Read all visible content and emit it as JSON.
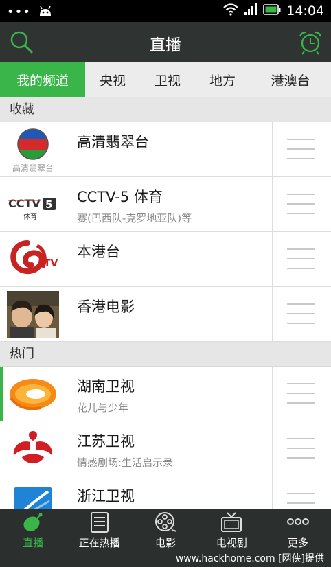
{
  "status_bar": {
    "time": "14:04"
  },
  "header": {
    "title": "直播"
  },
  "tabs": [
    {
      "label": "我的频道"
    },
    {
      "label": "央视"
    },
    {
      "label": "卫视"
    },
    {
      "label": "地方"
    },
    {
      "label": "港澳台"
    }
  ],
  "sections": {
    "favorites": {
      "title": "收藏",
      "channels": [
        {
          "name": "高清翡翠台",
          "sub": "",
          "logo_text": "高清翡翠台"
        },
        {
          "name": "CCTV-5 体育",
          "sub": "赛(巴西队-克罗地亚队)等",
          "logo_text": "体育"
        },
        {
          "name": "本港台",
          "sub": "",
          "logo_text": "TV"
        },
        {
          "name": "香港电影",
          "sub": ""
        }
      ]
    },
    "hot": {
      "title": "热门",
      "channels": [
        {
          "name": "湖南卫视",
          "sub": "花儿与少年"
        },
        {
          "name": "江苏卫视",
          "sub": "情感剧场:生活启示录"
        },
        {
          "name": "浙江卫视",
          "sub": ""
        }
      ]
    }
  },
  "bottom_nav": [
    {
      "label": "直播",
      "icon": "satellite-dish-icon",
      "active": true
    },
    {
      "label": "正在热播",
      "icon": "list-icon"
    },
    {
      "label": "电影",
      "icon": "film-reel-icon"
    },
    {
      "label": "电视剧",
      "icon": "tv-icon"
    },
    {
      "label": "更多",
      "icon": "more-icon"
    }
  ],
  "watermark": "www.hackhome.com [网侠]提供",
  "colors": {
    "accent": "#3ab549",
    "header_bg": "#2f3433",
    "nav_bg": "#2b2f2e"
  }
}
